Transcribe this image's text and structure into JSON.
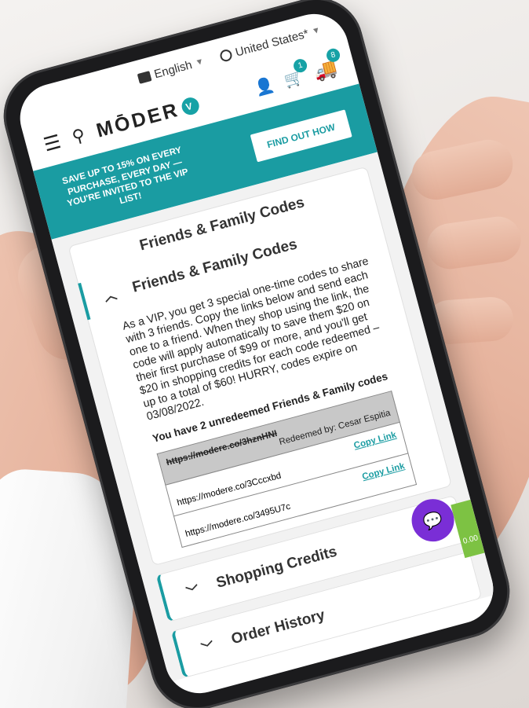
{
  "topbar": {
    "language": "English",
    "country": "United States*"
  },
  "header": {
    "logo_text": "MŌDER",
    "logo_badge": "V",
    "cart_count": "1",
    "truck_count": "8"
  },
  "promo": {
    "text": "SAVE UP TO 15% ON EVERY PURCHASE, EVERY DAY — YOU'RE INVITED TO THE VIP LIST!",
    "button": "FIND OUT HOW"
  },
  "codes_card": {
    "heading": "Friends & Family Codes",
    "accordion_title": "Friends & Family Codes",
    "description": "As a VIP, you get 3 special one-time codes to share with 3 friends. Copy the links below and send each one to a friend. When they shop using the link, the code will apply automatically to save them $20 on their first purchase of $99 or more, and you'll get $20 in shopping credits for each code redeemed – up to a total of $60! HURRY, codes expire on 03/08/2022.",
    "unredeemed_text": "You have 2 unredeemed Friends & Family codes",
    "rows": [
      {
        "link": "https://modere.co/3hznHNI",
        "status": "Redeemed by: Cesar Espitia",
        "redeemed": true
      },
      {
        "link": "https://modere.co/3Cccxbd",
        "status": "Copy Link",
        "redeemed": false
      },
      {
        "link": "https://modere.co/3495U7c",
        "status": "Copy Link",
        "redeemed": false
      }
    ]
  },
  "sections": [
    {
      "title": "Shopping Credits"
    },
    {
      "title": "Order History"
    }
  ],
  "floating": {
    "green_tab_value": "0.00"
  },
  "colors": {
    "accent": "#1a9ca2",
    "chat": "#7a2ed6",
    "green": "#7dc243"
  }
}
